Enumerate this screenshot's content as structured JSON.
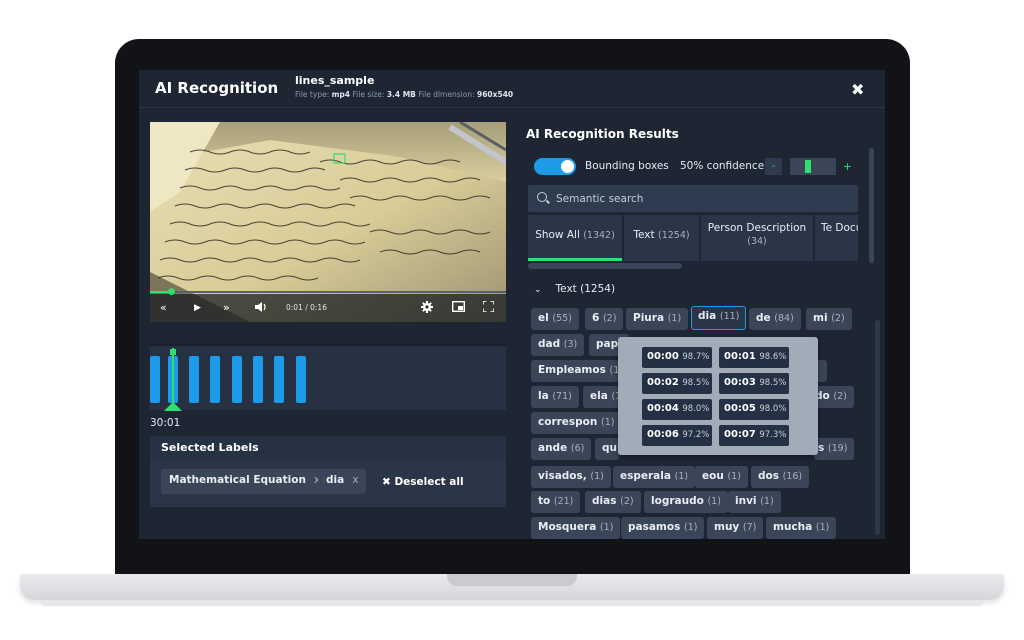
{
  "header": {
    "app_title": "AI Recognition",
    "file_name": "lines_sample",
    "file_type_label": "File type:",
    "file_type": "mp4",
    "file_size_label": "File size:",
    "file_size": "3.4 MB",
    "file_dimension_label": "File dimension:",
    "file_dimension": "960x540",
    "close_glyph": "✖"
  },
  "player": {
    "time": "0:01 / 0:16",
    "progress_fraction": 0.06,
    "icons": [
      "rewind-icon",
      "play-icon",
      "fast-forward-icon",
      "volume-icon",
      "settings-icon",
      "picture-in-picture-icon",
      "fullscreen-icon"
    ]
  },
  "timeline": {
    "current_time": "30:01"
  },
  "selected_labels": {
    "title": "Selected Labels",
    "chips": [
      {
        "label": "Mathematical Equation",
        "x": "x"
      },
      {
        "label": "dia",
        "x": "x"
      }
    ],
    "deselect_all": "✖ Deselect all"
  },
  "results": {
    "title": "AI Recognition Results",
    "bounding_boxes_label": "Bounding boxes",
    "bounding_boxes_on": true,
    "confidence_label": "50% confidence",
    "confidence_value": 0.5,
    "minus": "-",
    "plus": "+",
    "search_placeholder": "Semantic search",
    "tabs": [
      {
        "label": "Show All",
        "count": "(1342)"
      },
      {
        "label": "Text",
        "count": "(1254)"
      },
      {
        "label": "Person Description",
        "count": "(34)"
      },
      {
        "label": "Te Docu",
        "count": ""
      }
    ],
    "group": {
      "chevron": "⌄",
      "label": "Text (1254)"
    },
    "chips": [
      {
        "label": "el",
        "count": "(55)"
      },
      {
        "label": "6",
        "count": "(2)"
      },
      {
        "label": "Piura",
        "count": "(1)"
      },
      {
        "label": "dia",
        "count": "(11)"
      },
      {
        "label": "de",
        "count": "(84)"
      },
      {
        "label": "mi",
        "count": "(2)"
      },
      {
        "label": "dad",
        "count": "(3)"
      },
      {
        "label": "papa",
        "count": ""
      },
      {
        "label": "Empleamos",
        "count": "(1)"
      },
      {
        "label": "",
        "count": ")"
      },
      {
        "label": "la",
        "count": "(71)"
      },
      {
        "label": "ela",
        "count": "(1"
      },
      {
        "label": "do",
        "count": "(2)"
      },
      {
        "label": "correspon",
        "count": "(1)"
      },
      {
        "label": "ande",
        "count": "(6)"
      },
      {
        "label": "qu",
        "count": ""
      },
      {
        "label": "s",
        "count": "(19)"
      },
      {
        "label": "visados,",
        "count": "(1)"
      },
      {
        "label": "esperala",
        "count": "(1)"
      },
      {
        "label": "eou",
        "count": "(1)"
      },
      {
        "label": "dos",
        "count": "(16)"
      },
      {
        "label": "to",
        "count": "(21)"
      },
      {
        "label": "dias",
        "count": "(2)"
      },
      {
        "label": "lograudo",
        "count": "(1)"
      },
      {
        "label": "invi",
        "count": "(1)"
      },
      {
        "label": "Mosquera",
        "count": "(1)"
      },
      {
        "label": "pasamos",
        "count": "(1)"
      },
      {
        "label": "muy",
        "count": "(7)"
      },
      {
        "label": "mucha",
        "count": "(1)"
      }
    ],
    "tooltip_timestamps": [
      {
        "time": "00:00",
        "pct": "98.7%"
      },
      {
        "time": "00:01",
        "pct": "98.6%"
      },
      {
        "time": "00:02",
        "pct": "98.5%"
      },
      {
        "time": "00:03",
        "pct": "98.5%"
      },
      {
        "time": "00:04",
        "pct": "98.0%"
      },
      {
        "time": "00:05",
        "pct": "98.0%"
      },
      {
        "time": "00:06",
        "pct": "97.2%"
      },
      {
        "time": "00:07",
        "pct": "97.3%"
      }
    ]
  },
  "colors": {
    "accent_green": "#2ee06d",
    "accent_blue": "#1e9be8",
    "panel_bg": "#1e2634",
    "chip_bg": "#3a4658"
  }
}
